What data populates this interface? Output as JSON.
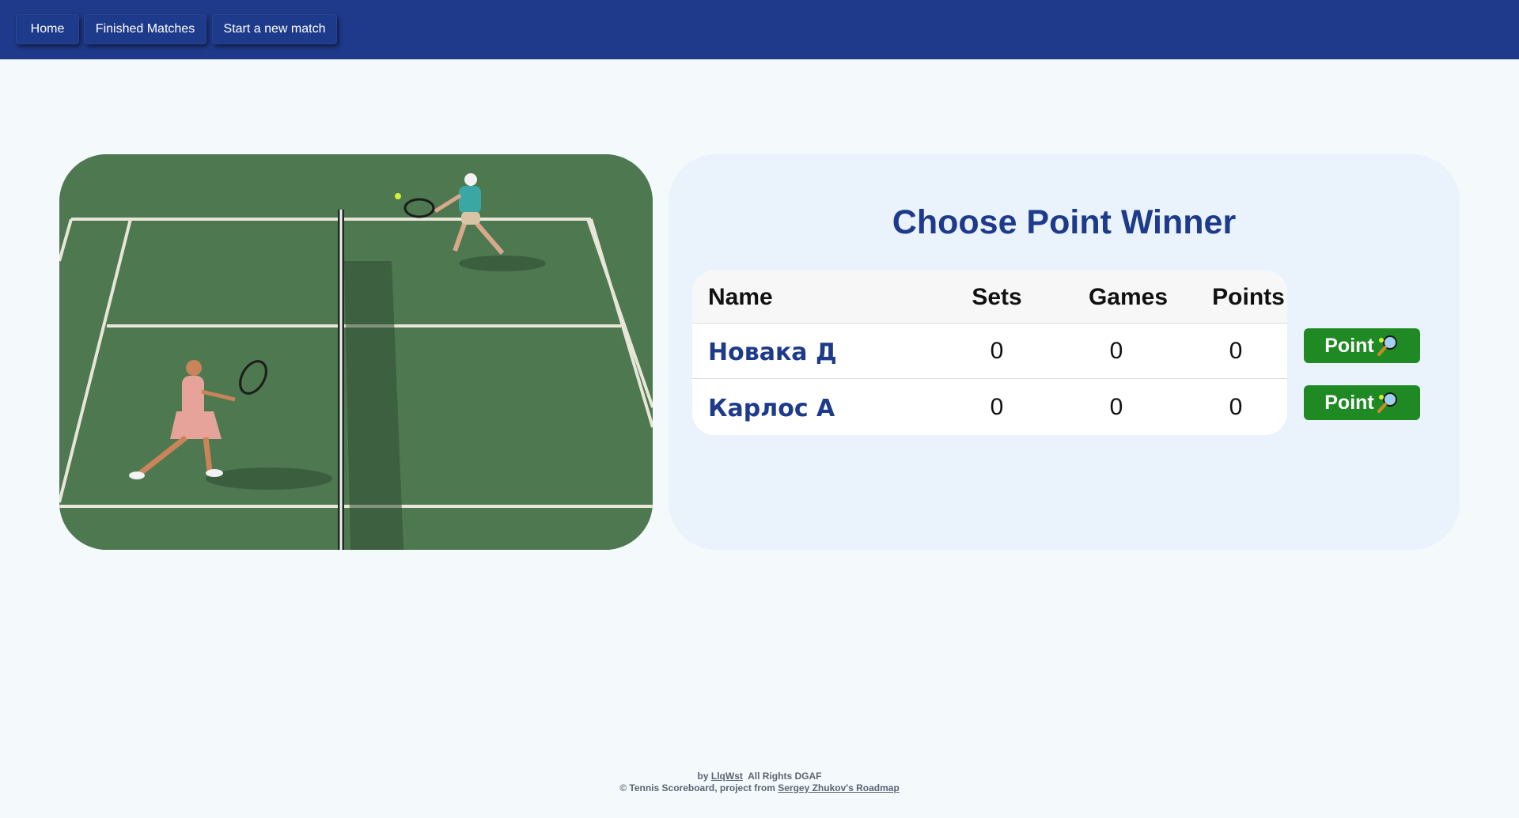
{
  "nav": {
    "home": "Home",
    "finished": "Finished Matches",
    "new_match": "Start a new match"
  },
  "colors": {
    "header": "#1f3a8a",
    "title": "#1e3a8a",
    "point_button": "#1f8a23",
    "background": "#f4f9fc"
  },
  "panel": {
    "title": "Choose Point Winner",
    "headers": {
      "name": "Name",
      "sets": "Sets",
      "games": "Games",
      "points": "Points"
    },
    "players": [
      {
        "name": "Новака Д",
        "sets": "0",
        "games": "0",
        "points": "0"
      },
      {
        "name": "Карлос А",
        "sets": "0",
        "games": "0",
        "points": "0"
      }
    ],
    "point_button_label": "Point",
    "point_button_icon": "tennis-racket-icon"
  },
  "image": {
    "icon": "tennis-court-photo"
  },
  "footer": {
    "by": "by",
    "author": "LlqWst",
    "rights": "All Rights DGAF",
    "copyright": "© Tennis Scoreboard, project from",
    "roadmap": "Sergey Zhukov's Roadmap"
  }
}
